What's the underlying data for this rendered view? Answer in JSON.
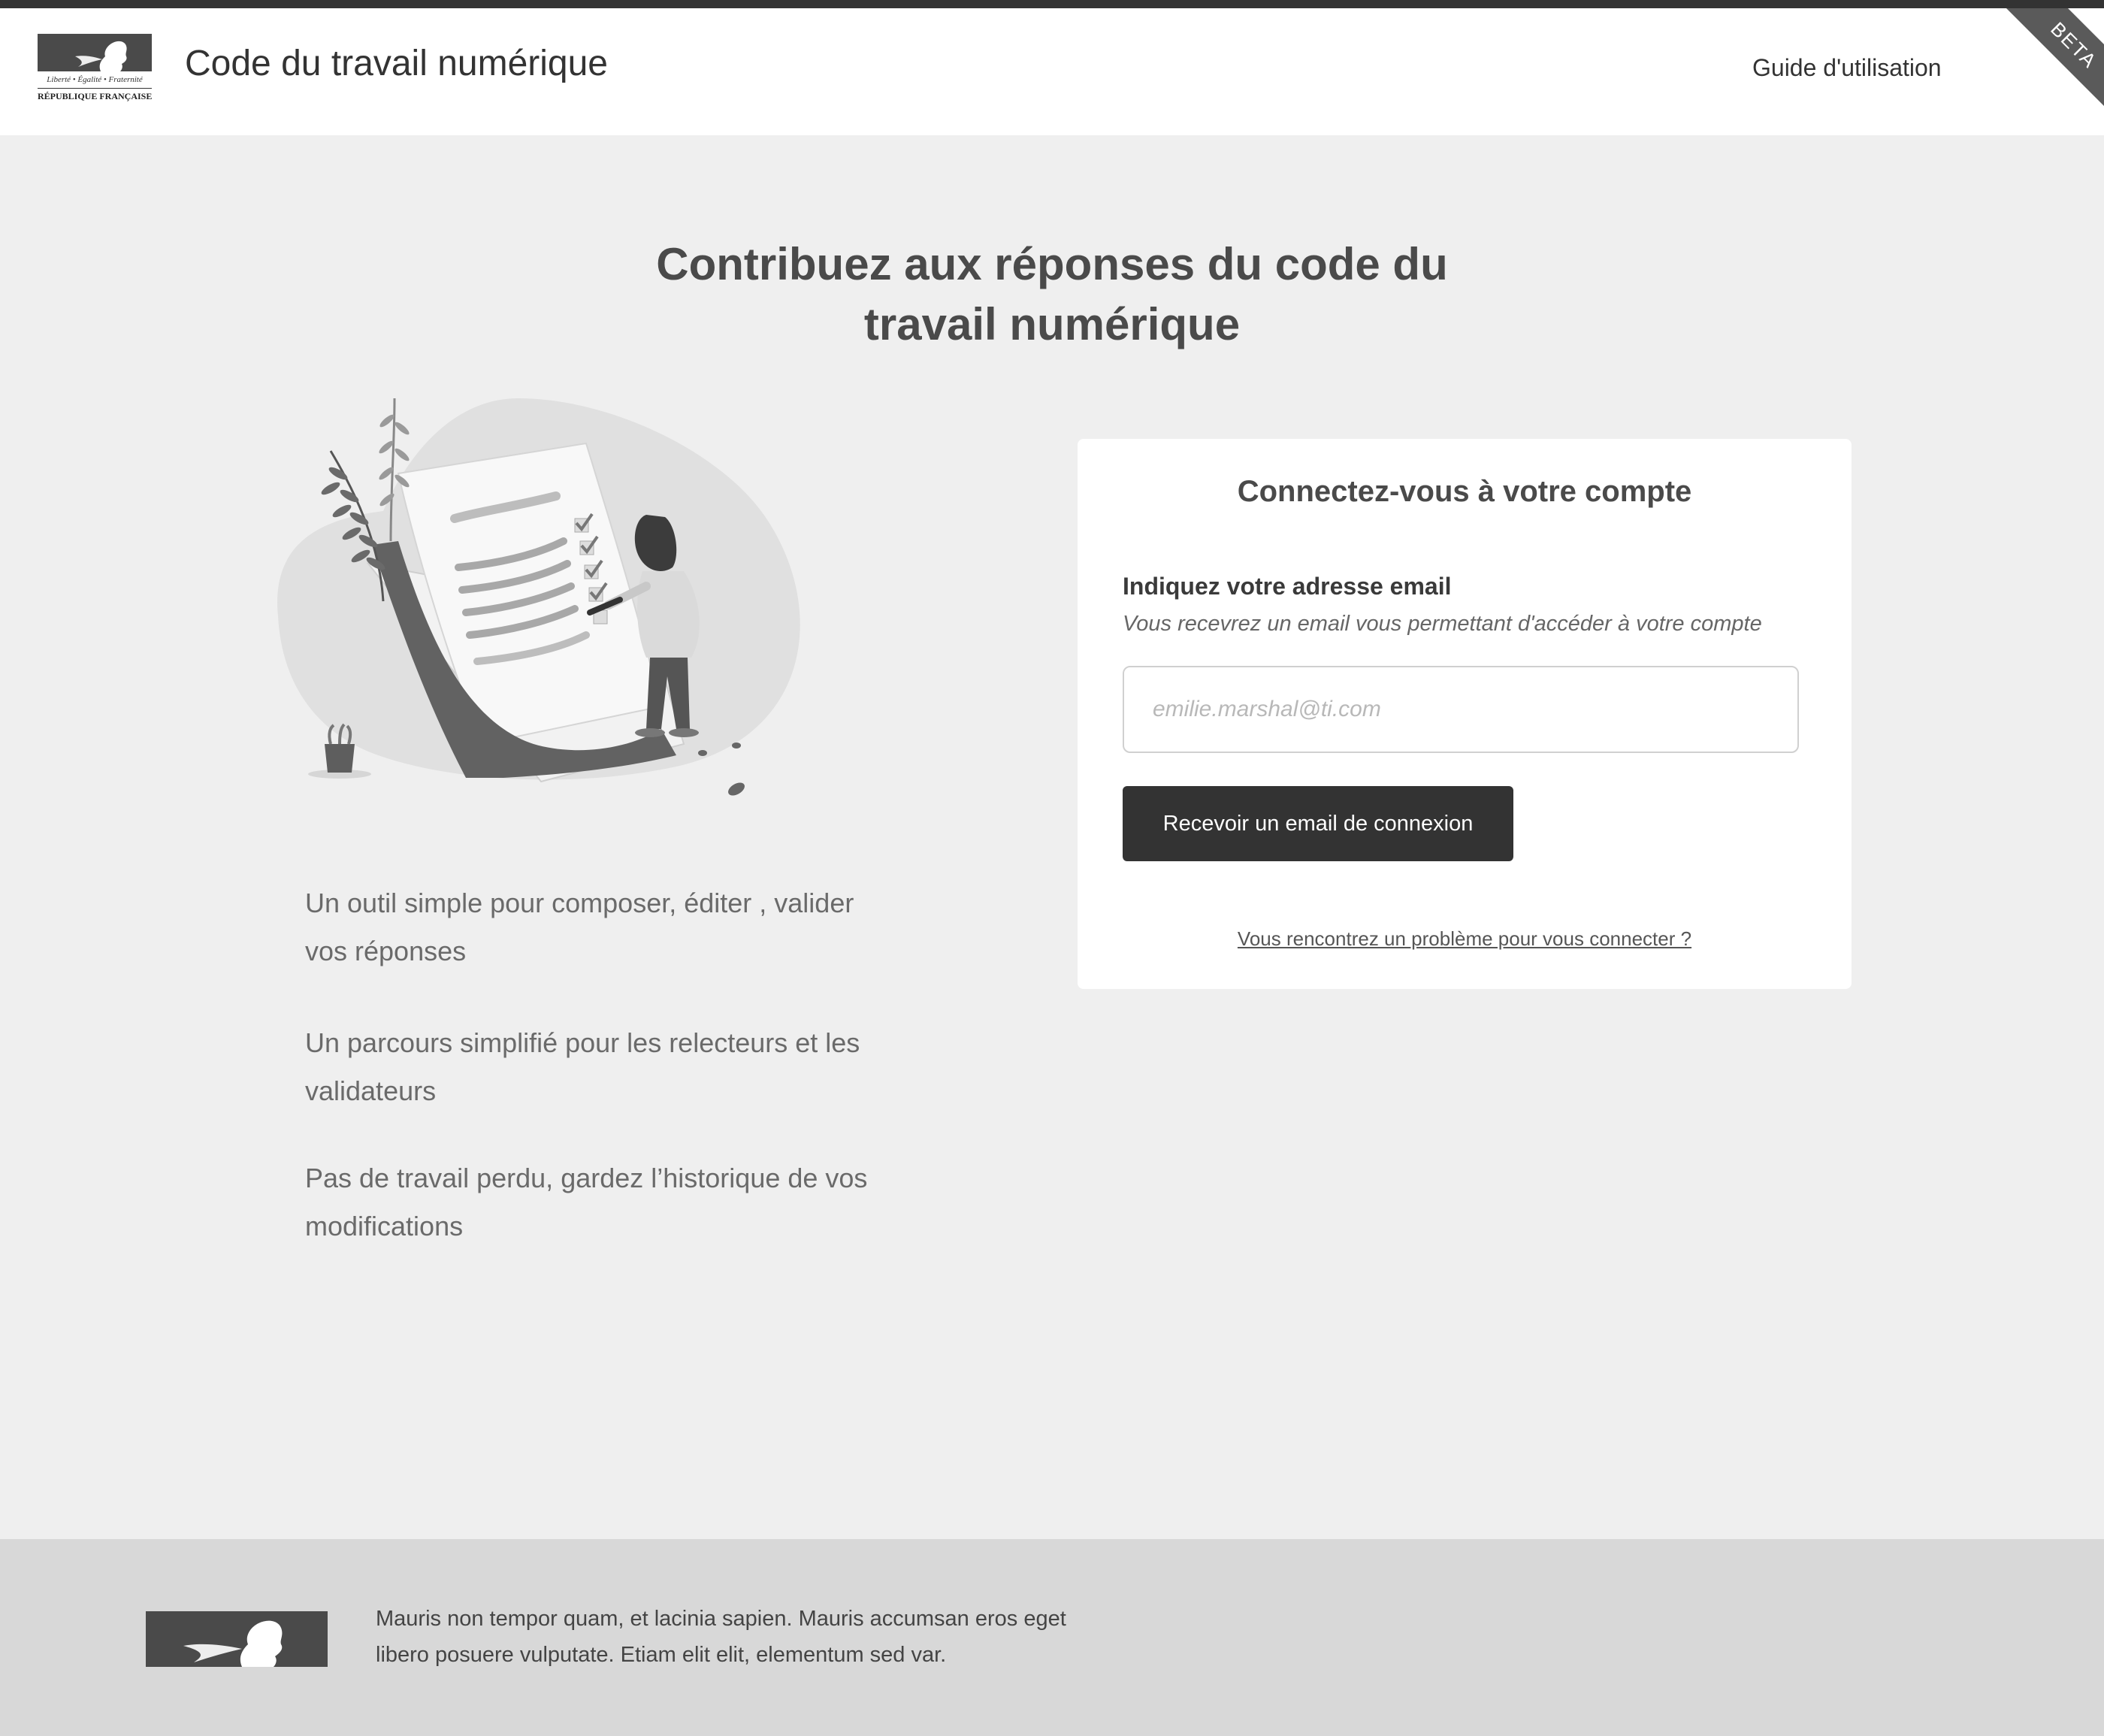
{
  "header": {
    "logo_motto": "Liberté • Égalité • Fraternité",
    "logo_name": "RÉPUBLIQUE FRANÇAISE",
    "site_title": "Code du travail numérique",
    "guide_link": "Guide d'utilisation",
    "beta_badge": "BETA"
  },
  "main": {
    "title_line1": "Contribuez aux réponses du code du",
    "title_line2": "travail numérique",
    "illustration_icon": "person-checking-document-illustration",
    "features": [
      "Un outil simple pour composer, éditer , valider vos réponses",
      "Un parcours simplifié pour les relecteurs et les validateurs",
      "Pas de travail perdu, gardez l’historique de vos modifications"
    ]
  },
  "login": {
    "title": "Connectez-vous à votre compte",
    "email_label": "Indiquez votre adresse email",
    "email_hint": "Vous recevrez un email vous permettant d'accéder à votre compte",
    "email_placeholder": "emilie.marshal@ti.com",
    "email_value": "",
    "submit_label": "Recevoir un email de connexion",
    "help_link": "Vous rencontrez un problème pour vous connecter ?"
  },
  "footer": {
    "logo_icon": "marianne-logo",
    "text": "Mauris non tempor quam, et lacinia sapien. Mauris accumsan eros eget libero posuere vulputate. Etiam elit elit, elementum sed var."
  },
  "colors": {
    "header_strip": "#333333",
    "page_background": "#efefef",
    "button_background": "#333333",
    "footer_background": "#d8d8d8"
  }
}
